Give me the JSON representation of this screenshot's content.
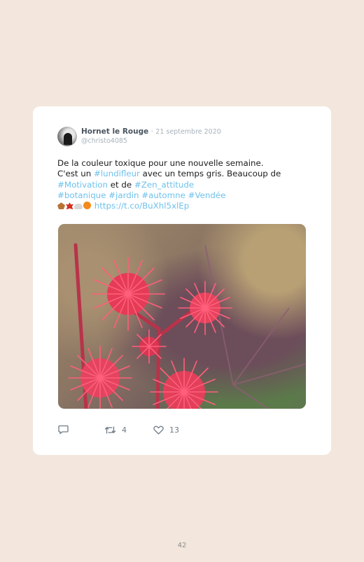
{
  "tweet": {
    "author_name": "Hornet le Rouge",
    "separator": "·",
    "date": "21 septembre 2020",
    "handle": "@christo4085",
    "text_lines": {
      "l1": "De la couleur toxique pour une nouvelle semaine.",
      "l2_a": "C'est un ",
      "l2_tag": "#lundifleur",
      "l2_b": " avec un temps gris. Beaucoup de",
      "l3_tag1": "#Motivation",
      "l3_mid": " et de ",
      "l3_tag2": "#Zen_attitude",
      "l4_tag1": "#botanique",
      "l4_tag2": "#jardin",
      "l4_tag3": "#automne",
      "l4_tag4": "#Vendée",
      "l5_link": "https://t.co/BuXhl5xlEp"
    },
    "emojis": [
      "fallen-leaf",
      "maple-leaf",
      "cloud",
      "jack-o-lantern"
    ],
    "image_subject": "flower-photo",
    "actions": {
      "reply_count": "",
      "retweet_count": "4",
      "like_count": "13"
    }
  },
  "page_number": "42",
  "colors": {
    "background": "#f3e7dd",
    "card": "#ffffff",
    "link": "#6ec1ec",
    "meta": "#a7b2bb"
  }
}
